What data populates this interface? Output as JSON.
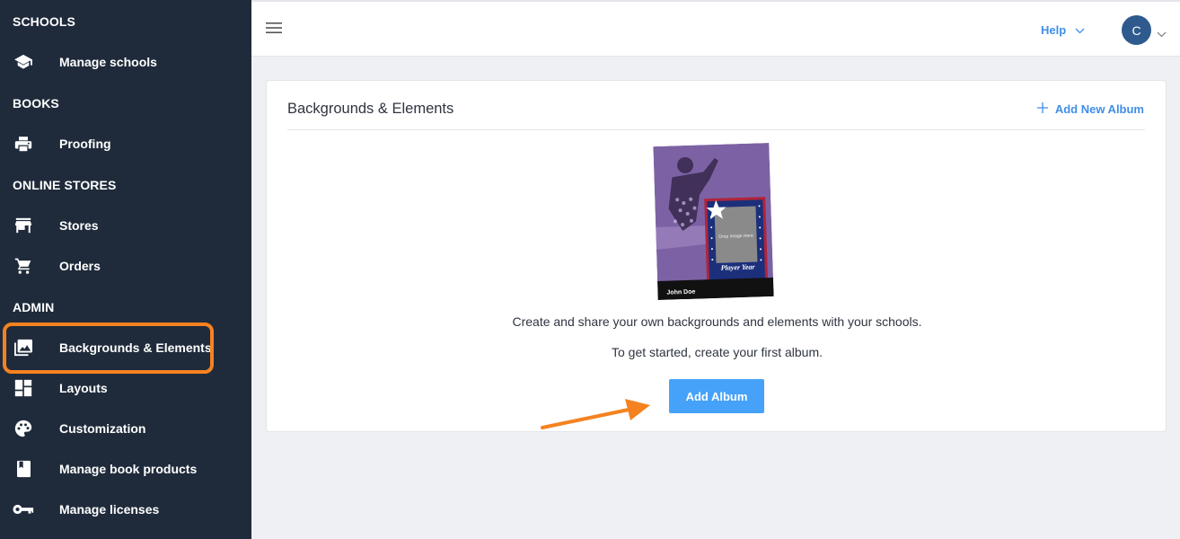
{
  "sidebar": {
    "sections": [
      {
        "title": "SCHOOLS"
      },
      {
        "title": "BOOKS"
      },
      {
        "title": "ONLINE STORES"
      },
      {
        "title": "ADMIN"
      }
    ],
    "items": [
      {
        "label": "Manage schools",
        "icon": "graduation-cap-icon"
      },
      {
        "label": "Proofing",
        "icon": "printer-icon"
      },
      {
        "label": "Stores",
        "icon": "store-icon"
      },
      {
        "label": "Orders",
        "icon": "cart-icon"
      },
      {
        "label": "Backgrounds & Elements",
        "icon": "photo-library-icon",
        "active": true
      },
      {
        "label": "Layouts",
        "icon": "dashboard-icon"
      },
      {
        "label": "Customization",
        "icon": "palette-icon"
      },
      {
        "label": "Manage book products",
        "icon": "book-icon"
      },
      {
        "label": "Manage licenses",
        "icon": "key-icon"
      }
    ]
  },
  "topbar": {
    "help_label": "Help",
    "avatar_initial": "C"
  },
  "card": {
    "title": "Backgrounds & Elements",
    "add_new_label": "Add New Album",
    "thumbnail": {
      "name_text": "John Doe",
      "drop_text": "Drop Image Here",
      "badge_text": "Player Year"
    },
    "description": "Create and share your own backgrounds and elements with your schools.",
    "hint": "To get started, create your first album.",
    "add_album_label": "Add Album"
  },
  "colors": {
    "sidebar_bg": "#1f2b3b",
    "accent": "#45a2f8",
    "link": "#3f8ee8",
    "highlight": "#f58220",
    "avatar": "#2f5a8d"
  }
}
